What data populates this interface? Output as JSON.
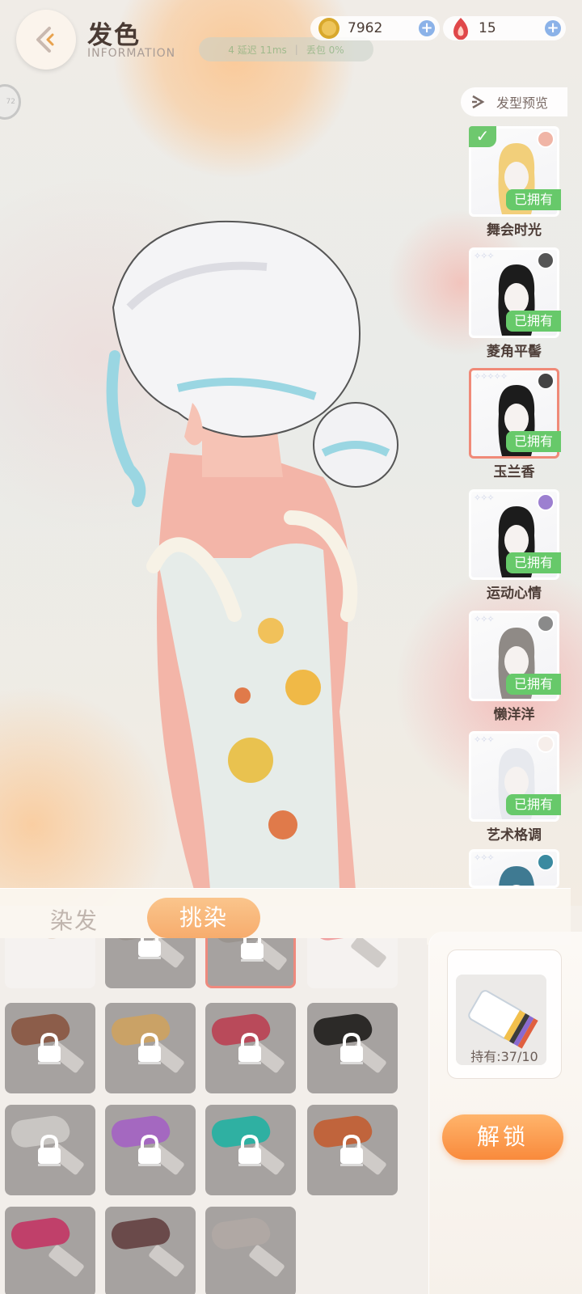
{
  "header": {
    "title": "发色",
    "subtitle": "INFORMATION",
    "network": {
      "delay": "4 延迟 11ms",
      "loss": "丢包 0%"
    },
    "side_badge": "72"
  },
  "currency": {
    "gold": "7962",
    "gems": "15",
    "gold_color": "#d8a82c",
    "gem_color": "#e0484a"
  },
  "preview": {
    "label": "发型预览",
    "items": [
      {
        "name": "舞会时光",
        "owned": "已拥有",
        "stars": "",
        "selected_check": true,
        "rarity_color": "#f0b5a6",
        "hair_color": "#f2cf7a"
      },
      {
        "name": "菱角平髻",
        "owned": "已拥有",
        "stars": "✧✧✧",
        "rarity_color": "#555555",
        "hair_color": "#1c1c1c"
      },
      {
        "name": "玉兰香",
        "owned": "已拥有",
        "stars": "✧✧✧✧✧",
        "rarity_color": "#444444",
        "hair_color": "#1c1c1c"
      },
      {
        "name": "运动心情",
        "owned": "已拥有",
        "stars": "✧✧✧",
        "rarity_color": "#9c7fd0",
        "hair_color": "#1c1c1c"
      },
      {
        "name": "懒洋洋",
        "owned": "已拥有",
        "stars": "✧✧✧",
        "rarity_color": "#8a8a8a",
        "hair_color": "#8f8a86"
      },
      {
        "name": "艺术格调",
        "owned": "已拥有",
        "stars": "✧✧✧",
        "rarity_color": "#f6eeea",
        "hair_color": "#e7e9ee"
      },
      {
        "name": "",
        "owned": "",
        "stars": "✧✧✧",
        "rarity_color": "#3a8aa0",
        "hair_color": "#3f7a92"
      }
    ]
  },
  "tabs": {
    "dye": "染发",
    "highlight": "挑染"
  },
  "swatches": [
    {
      "color": "",
      "locked": false
    },
    {
      "color": "#9a948f",
      "locked": true
    },
    {
      "color": "#9a948f",
      "locked": true
    },
    {
      "color": "#f0a0a0",
      "locked": false
    },
    {
      "color": "#8c5d4a",
      "locked": true
    },
    {
      "color": "#caa266",
      "locked": true
    },
    {
      "color": "#b94a5a",
      "locked": true
    },
    {
      "color": "#2c2a28",
      "locked": true
    },
    {
      "color": "#c9c6c3",
      "locked": true
    },
    {
      "color": "#a468c0",
      "locked": true
    },
    {
      "color": "#2fb0a2",
      "locked": true
    },
    {
      "color": "#c0643c",
      "locked": true
    },
    {
      "color": "#c0406a",
      "locked": false
    },
    {
      "color": "#6a4a4a",
      "locked": false
    },
    {
      "color": "#b0a8a4",
      "locked": false
    }
  ],
  "item": {
    "hold": "持有:37/10"
  },
  "unlock": "解锁"
}
